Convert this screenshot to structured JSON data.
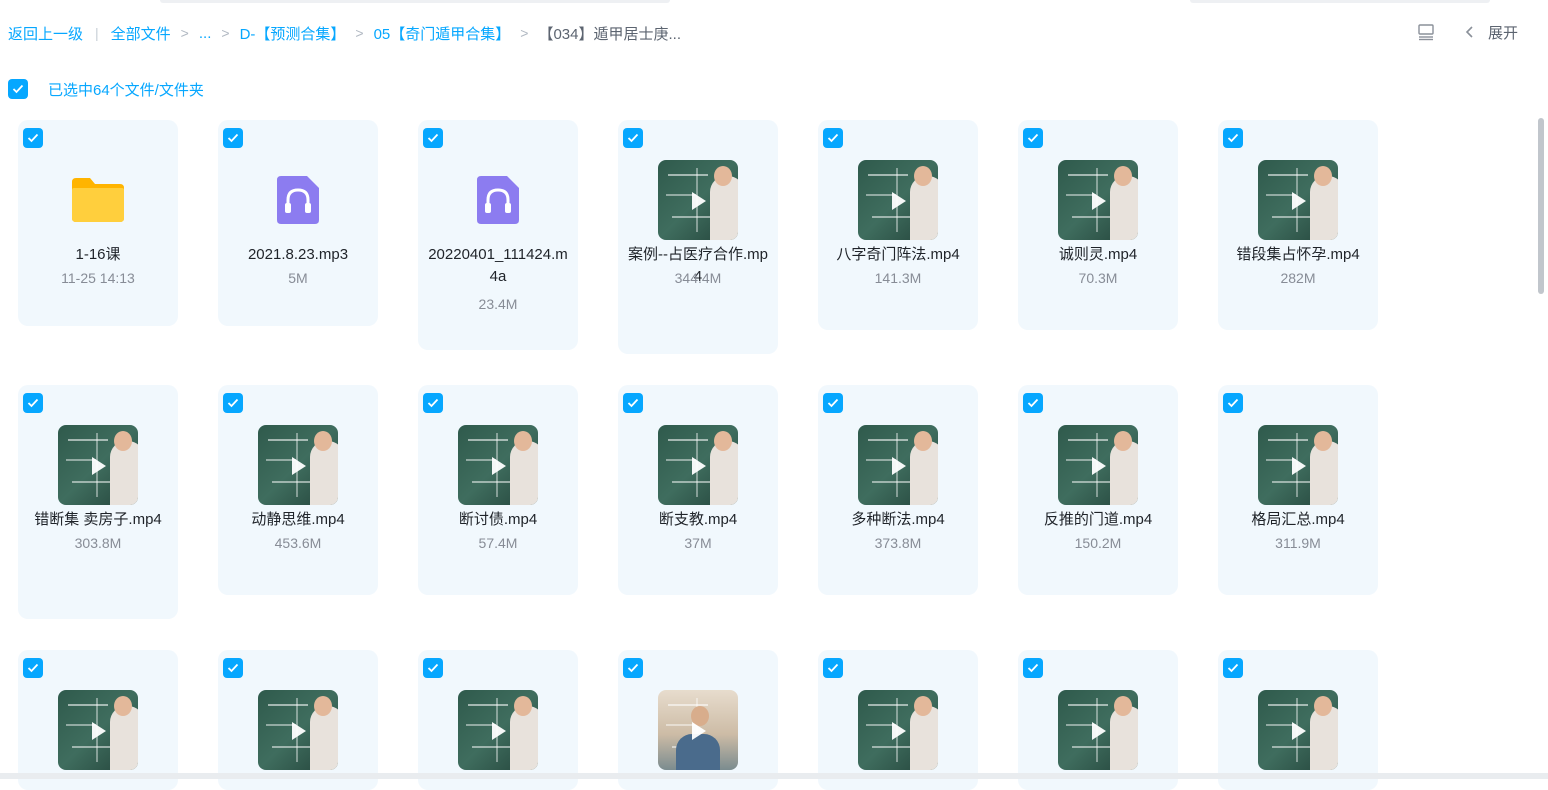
{
  "breadcrumb": {
    "back": "返回上一级",
    "items": [
      "全部文件",
      "...",
      "D-【预测合集】",
      "05【奇门遁甲合集】"
    ],
    "current": "【034】遁甲居士庚..."
  },
  "toolbar": {
    "expand_label": "展开"
  },
  "selection": {
    "label": "已选中64个文件/文件夹"
  },
  "colors": {
    "accent": "#06a7ff",
    "card_bg": "#f1f8fd",
    "folder": "#ffc53d",
    "audio": "#8c7cf0"
  },
  "files": [
    {
      "name": "1-16课",
      "meta": "11-25 14:13",
      "type": "folder"
    },
    {
      "name": "2021.8.23.mp3",
      "meta": "5M",
      "type": "audio"
    },
    {
      "name": "20220401_111424.m4a",
      "meta": "23.4M",
      "type": "audio"
    },
    {
      "name": "案例--占医疗合作.mp4",
      "meta": "344.4M",
      "type": "video"
    },
    {
      "name": "八字奇门阵法.mp4",
      "meta": "141.3M",
      "type": "video"
    },
    {
      "name": "诚则灵.mp4",
      "meta": "70.3M",
      "type": "video"
    },
    {
      "name": "错段集占怀孕.mp4",
      "meta": "282M",
      "type": "video"
    },
    {
      "name": "错断集 卖房子.mp4",
      "meta": "303.8M",
      "type": "video"
    },
    {
      "name": "动静思维.mp4",
      "meta": "453.6M",
      "type": "video"
    },
    {
      "name": "断讨债.mp4",
      "meta": "57.4M",
      "type": "video"
    },
    {
      "name": "断支教.mp4",
      "meta": "37M",
      "type": "video"
    },
    {
      "name": "多种断法.mp4",
      "meta": "373.8M",
      "type": "video"
    },
    {
      "name": "反推的门道.mp4",
      "meta": "150.2M",
      "type": "video"
    },
    {
      "name": "格局汇总.mp4",
      "meta": "311.9M",
      "type": "video"
    },
    {
      "name": "",
      "meta": "",
      "type": "video"
    },
    {
      "name": "",
      "meta": "",
      "type": "video"
    },
    {
      "name": "",
      "meta": "",
      "type": "video"
    },
    {
      "name": "",
      "meta": "",
      "type": "video"
    },
    {
      "name": "",
      "meta": "",
      "type": "video"
    },
    {
      "name": "",
      "meta": "",
      "type": "video"
    },
    {
      "name": "",
      "meta": "",
      "type": "video"
    }
  ]
}
